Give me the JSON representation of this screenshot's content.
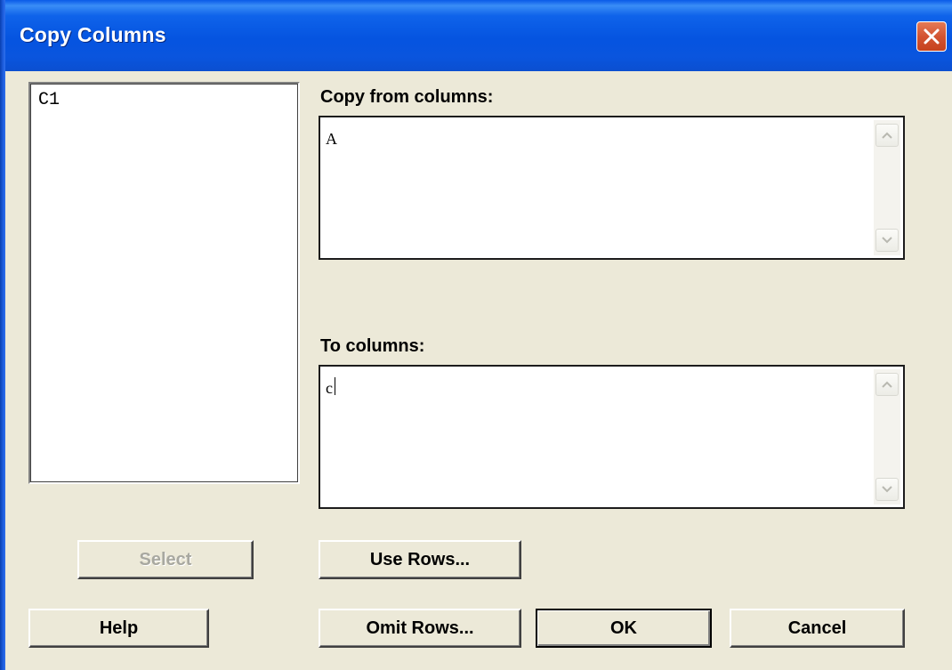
{
  "window": {
    "title": "Copy Columns"
  },
  "variables_list": {
    "items": [
      "C1"
    ]
  },
  "copy_from": {
    "label": "Copy from columns:",
    "value": "A"
  },
  "to_columns": {
    "label": "To columns:",
    "value": "c"
  },
  "buttons": {
    "select": "Select",
    "use_rows": "Use Rows...",
    "help": "Help",
    "omit_rows": "Omit Rows...",
    "ok": "OK",
    "cancel": "Cancel"
  },
  "colors": {
    "titlebar": "#0554E0",
    "dialog_bg": "#ECE9D8",
    "close_button": "#D35432"
  }
}
